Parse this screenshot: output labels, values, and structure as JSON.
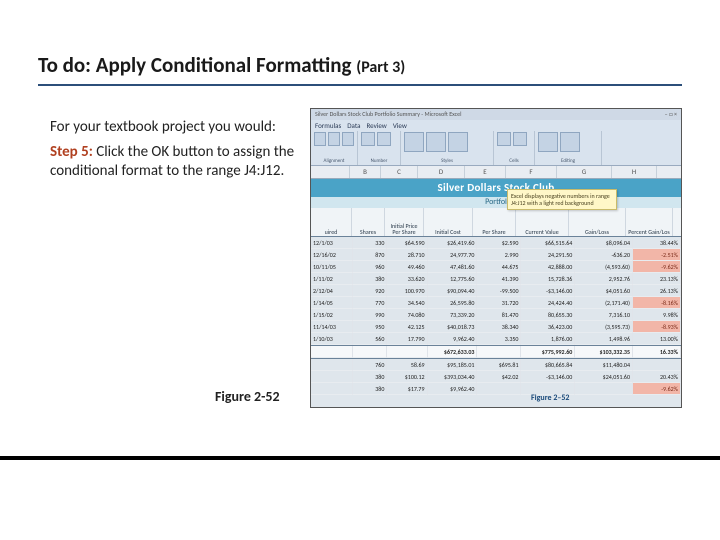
{
  "title": {
    "main": "To do: Apply Conditional Formatting",
    "part": "(Part 3)"
  },
  "body": {
    "intro": "For your textbook project you would:",
    "step_label": "Step 5:",
    "step_text": "  Click the OK button to assign the conditional format to the range J4:J12."
  },
  "caption": "Figure 2-52",
  "embed": {
    "window_title": "Silver Dollars Stock Club Portfolio Summary - Microsoft Excel",
    "tabs": [
      "Formulas",
      "Data",
      "Review",
      "View"
    ],
    "groups": {
      "align": "Alignment",
      "num": "Number",
      "styles": "Styles",
      "cells": "Cells",
      "edit": "Editing"
    },
    "style_btns": {
      "cond": "Conditional Formatting",
      "table": "Format as Table",
      "cell": "Cell Styles"
    },
    "edit_btns": {
      "sort": "Sort & Filter",
      "find": "Find & Select"
    },
    "col_letters": [
      "",
      "B",
      "C",
      "D",
      "E",
      "F",
      "G",
      "H"
    ],
    "sheet_title": "Silver Dollars Stock Club",
    "sheet_sub": "Portfol",
    "callout": "Excel displays negative numbers in range J4:J12 with a light red background",
    "headers": [
      "uired",
      "Shares",
      "Initial Price Per Share",
      "Initial Cost",
      "Per Share",
      "Current Value",
      "Gain/Loss",
      "Percent Gain/Los"
    ],
    "rows": [
      {
        "d": "12/1/03",
        "sh": "330",
        "ipps": "$64.590",
        "ic": "$26,419.60",
        "ps": "$2.590",
        "cv": "$66,515.64",
        "gl": "$8,096.04",
        "pct": "38.44%"
      },
      {
        "d": "12/16/02",
        "sh": "870",
        "ipps": "28.710",
        "ic": "24,977.70",
        "ps": "2.990",
        "cv": "24,291.50",
        "gl": "-636.20",
        "pct": "-2.51%",
        "neg": true
      },
      {
        "d": "10/11/05",
        "sh": "960",
        "ipps": "49.460",
        "ic": "47,481.60",
        "ps": "44.675",
        "cv": "42,888.00",
        "gl": "(4,593.60)",
        "pct": "-9.62%",
        "neg": true
      },
      {
        "d": "1/11/02",
        "sh": "380",
        "ipps": "33.620",
        "ic": "12,775.60",
        "ps": "41.390",
        "cv": "15,728.36",
        "gl": "2,952.76",
        "pct": "23.13%"
      },
      {
        "d": "2/12/04",
        "sh": "920",
        "ipps": "100.970",
        "ic": "$90,094.40",
        "ps": "-99.500",
        "cv": "-$3,146.00",
        "gl": "$4,051.60",
        "pct": "26.13%"
      },
      {
        "d": "1/14/05",
        "sh": "770",
        "ipps": "34.540",
        "ic": "26,595.80",
        "ps": "31.720",
        "cv": "24,424.40",
        "gl": "(2,171.40)",
        "pct": "-8.16%",
        "neg": true
      },
      {
        "d": "1/15/02",
        "sh": "990",
        "ipps": "74.080",
        "ic": "73,339.20",
        "ps": "81.470",
        "cv": "80,655.30",
        "gl": "7,316.10",
        "pct": "9.98%"
      },
      {
        "d": "11/14/03",
        "sh": "950",
        "ipps": "42.125",
        "ic": "$40,018.73",
        "ps": "38.340",
        "cv": "36,423.00",
        "gl": "(3,595.73)",
        "pct": "-8.93%",
        "neg": true
      },
      {
        "d": "1/10/03",
        "sh": "560",
        "ipps": "17.790",
        "ic": "9,962.40",
        "ps": "3.350",
        "cv": "1,876.00",
        "gl": "1,498.96",
        "pct": "13.00%"
      }
    ],
    "total": {
      "d": "",
      "sh": "",
      "ipps": "",
      "ic": "$672,633.03",
      "ps": "",
      "cv": "$775,992.60",
      "gl": "$103,332.35",
      "pct": "16.33%"
    },
    "extra": [
      {
        "d": "",
        "sh": "760",
        "ipps": "58.69",
        "ic": "$95,185.01",
        "ps": "$695.81",
        "cv": "$80,665.84",
        "gl": "$11,480.04",
        "pct": ""
      },
      {
        "d": "",
        "sh": "380",
        "ipps": "$100.12",
        "ic": "$393,034.40",
        "ps": "$42.02",
        "cv": "-$3,146.00",
        "gl": "$24,051.60",
        "pct": "20.43%"
      },
      {
        "d": "",
        "sh": "380",
        "ipps": "$17.79",
        "ic": "$9,962.40",
        "ps": "",
        "cv": "",
        "gl": "",
        "pct": "-9.62%",
        "neg": true
      }
    ],
    "fig_label": "Figure 2–52"
  }
}
